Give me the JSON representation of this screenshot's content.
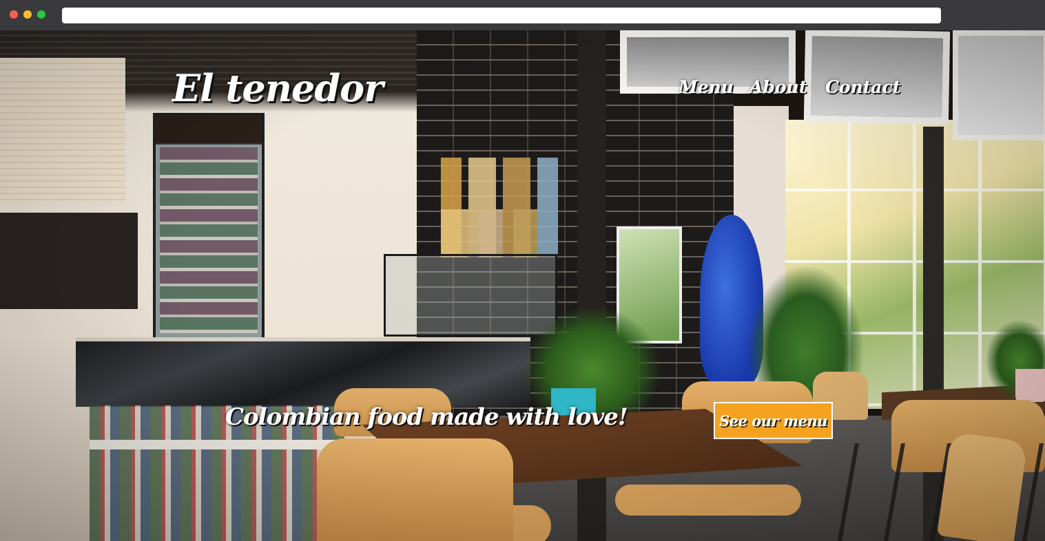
{
  "browser": {
    "window_buttons": [
      "close",
      "minimize",
      "maximize"
    ],
    "url": ""
  },
  "site": {
    "logo": "El tenedor",
    "nav": [
      {
        "label": "Menu"
      },
      {
        "label": "About"
      },
      {
        "label": "Contact"
      }
    ],
    "tagline": "Colombian food made with love!",
    "cta_label": "See our menu"
  },
  "colors": {
    "accent": "#f5a221",
    "text": "#ffffff"
  }
}
